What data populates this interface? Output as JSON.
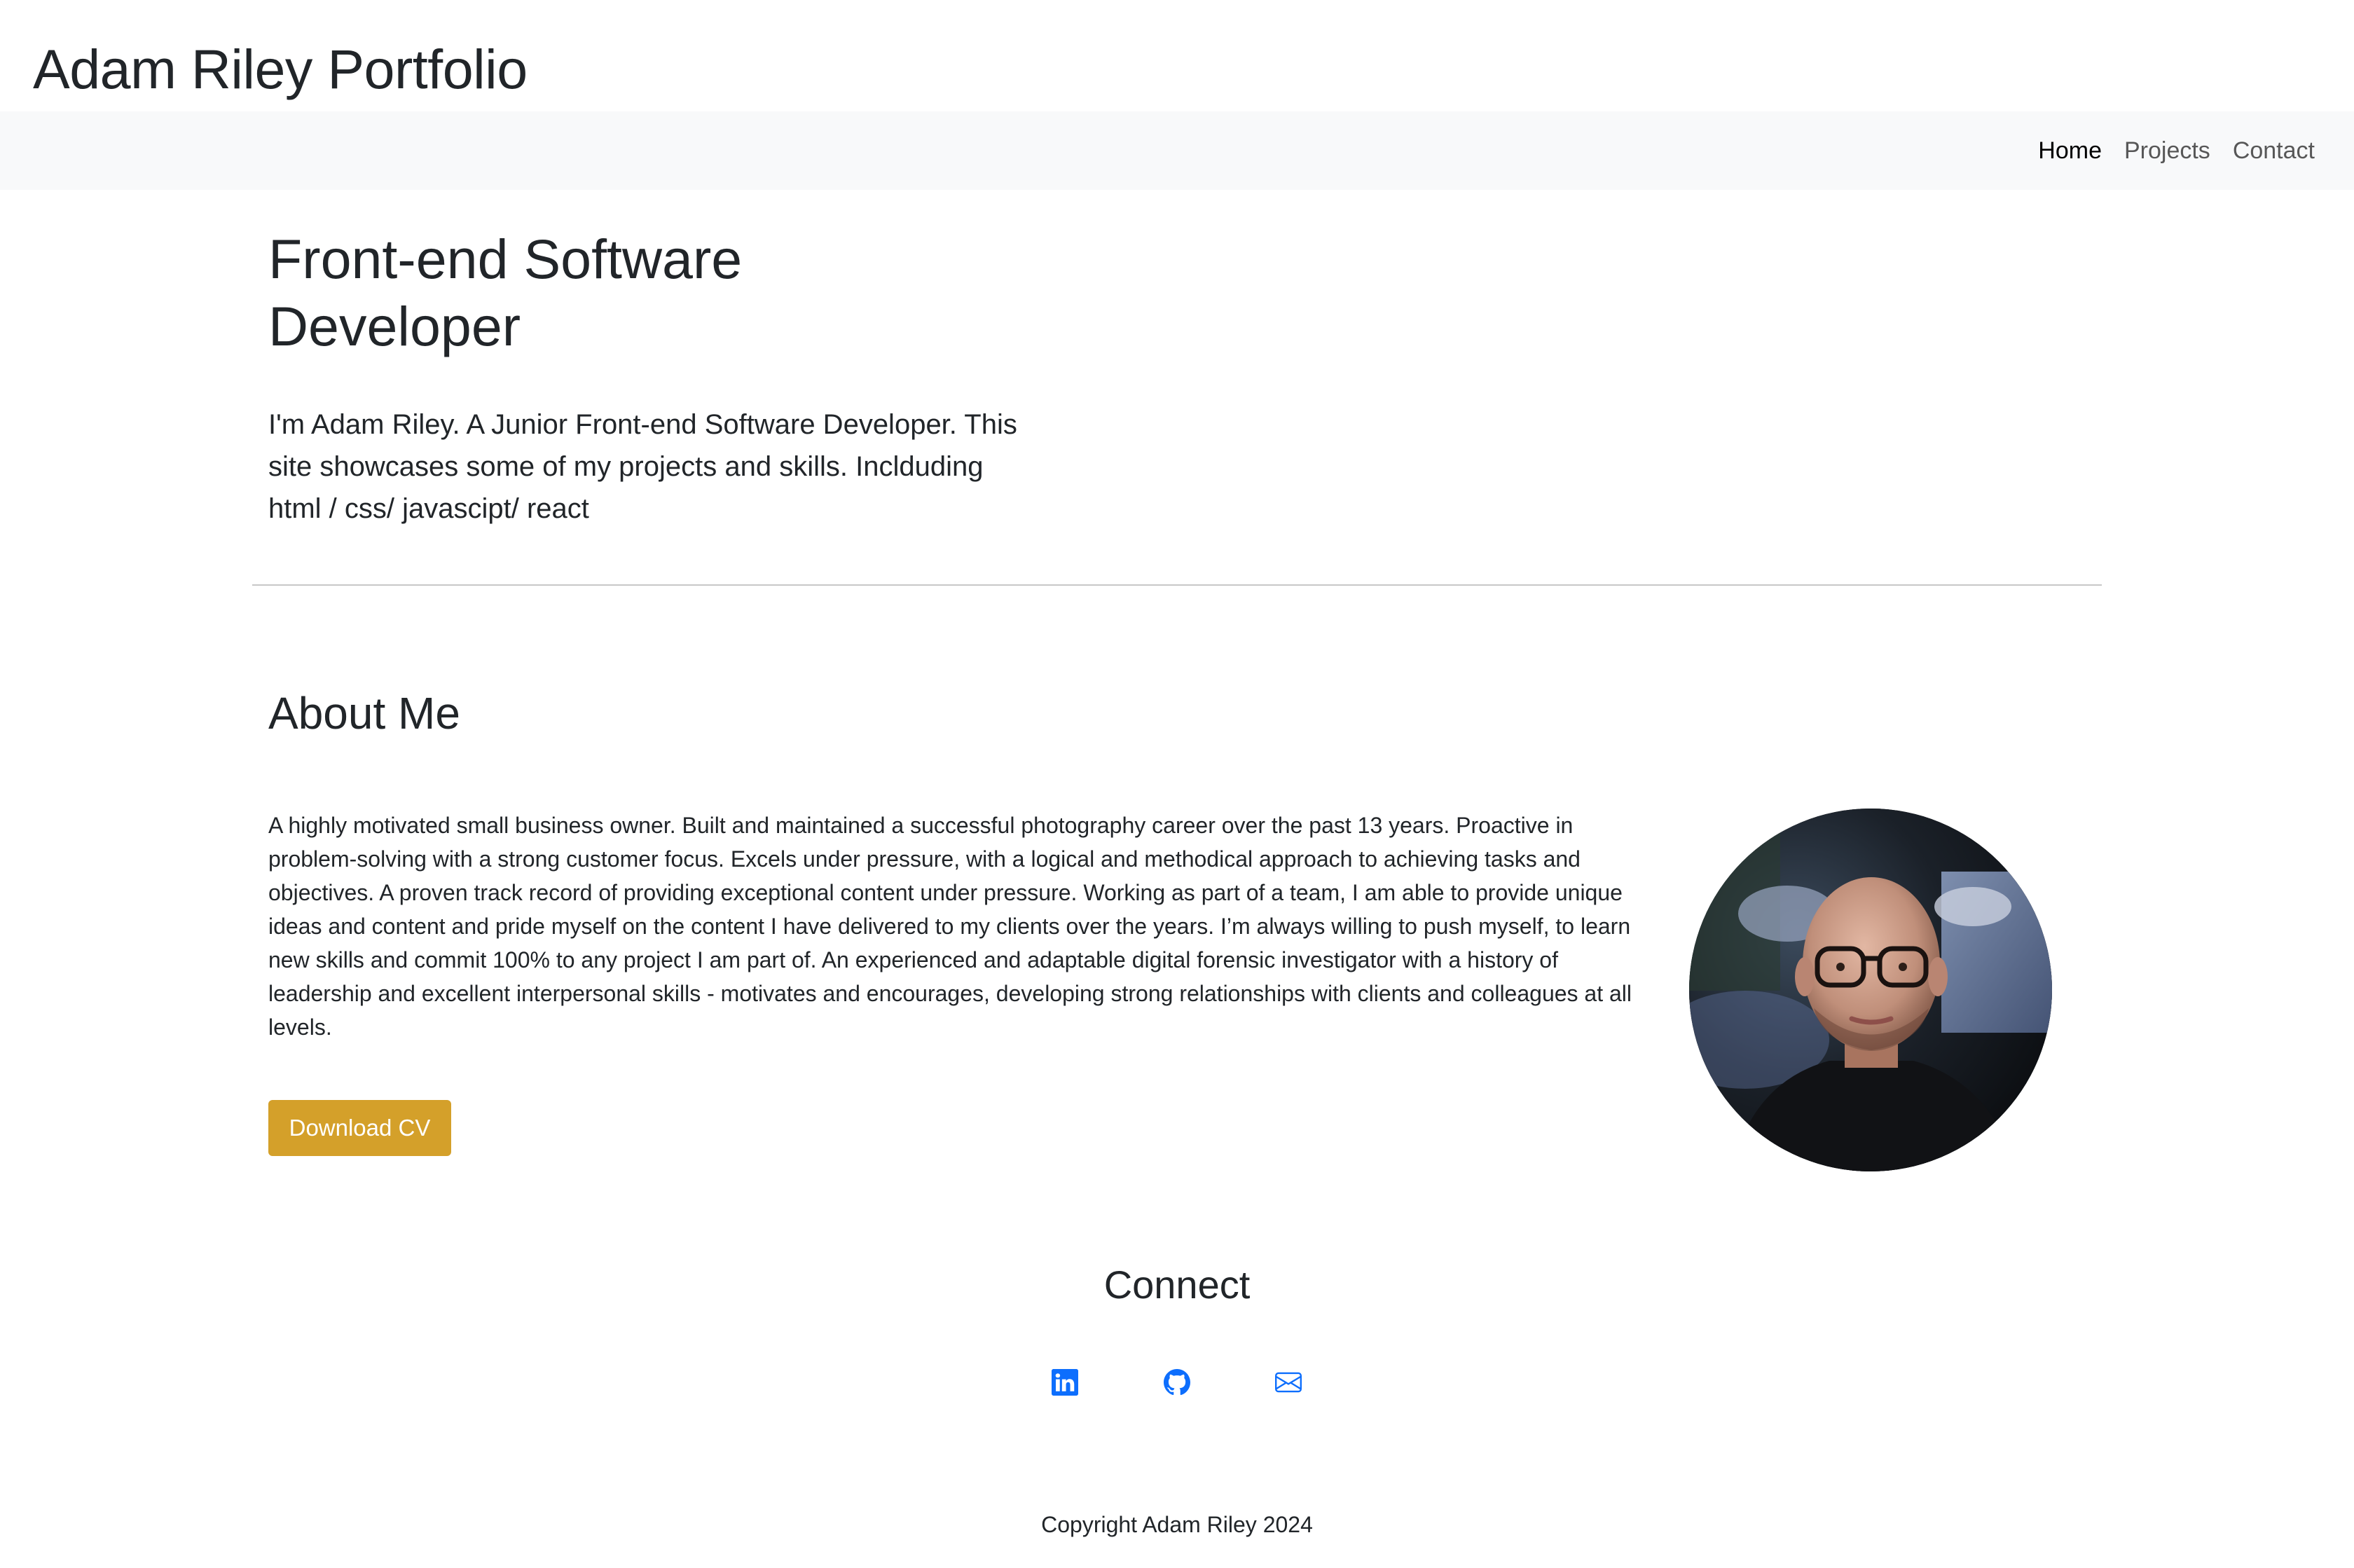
{
  "header": {
    "title": "Adam Riley Portfolio"
  },
  "nav": {
    "items": [
      {
        "label": "Home",
        "active": true
      },
      {
        "label": "Projects",
        "active": false
      },
      {
        "label": "Contact",
        "active": false
      }
    ]
  },
  "hero": {
    "title_line1": "Front-end Software",
    "title_line2": "Developer",
    "lead": "I'm Adam Riley. A Junior Front-end Software Developer. This site showcases some of my projects and skills. Inclduding html / css/ javascipt/ react"
  },
  "about": {
    "title": "About Me",
    "text": "A highly motivated small business owner. Built and maintained a successful photography career over the past 13 years. Proactive in problem-solving with a strong customer focus. Excels under pressure, with a logical and methodical approach to achieving tasks and objectives. A proven track record of providing exceptional content under pressure. Working as part of a team, I am able to provide unique ideas and content and pride myself on the content I have delivered to my clients over the years. I’m always willing to push myself, to learn new skills and commit 100% to any project I am part of. An experienced and adaptable digital forensic investigator with a history of leadership and excellent interpersonal skills - motivates and encourages, developing strong relationships with clients and colleagues at all levels.",
    "button_label": "Download CV",
    "button_color": "#d4a02a"
  },
  "connect": {
    "title": "Connect",
    "icons": [
      "linkedin-icon",
      "github-icon",
      "envelope-icon"
    ],
    "icon_color": "#0d6efd"
  },
  "footer": {
    "copyright": "Copyright Adam Riley 2024"
  }
}
